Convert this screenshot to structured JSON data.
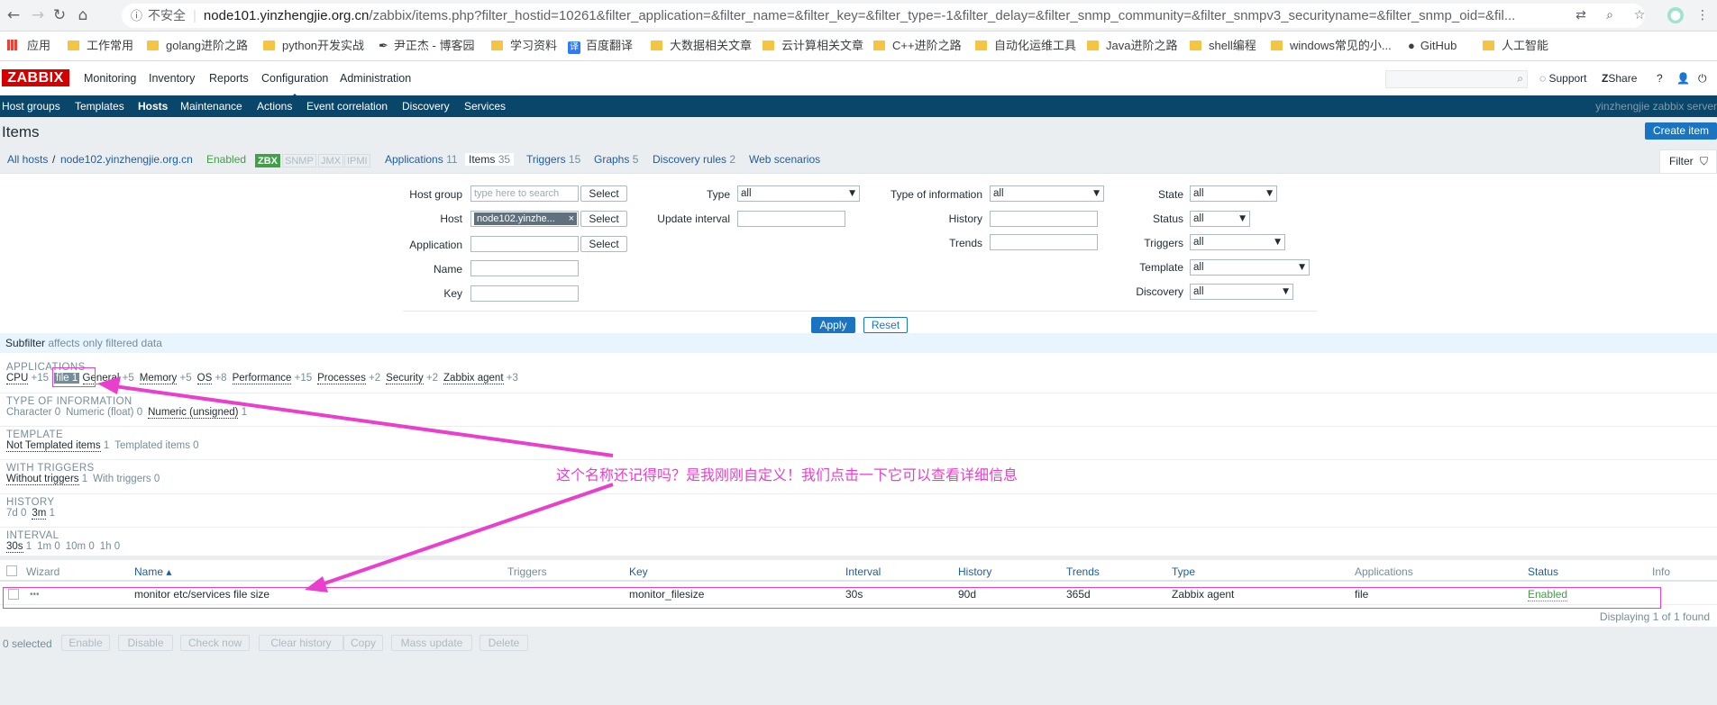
{
  "browser": {
    "insecure_label": "不安全",
    "url_domain": "node101.yinzhengjie.org.cn",
    "url_path": "/zabbix/items.php?filter_hostid=10261&filter_application=&filter_name=&filter_key=&filter_type=-1&filter_delay=&filter_snmp_community=&filter_snmpv3_securityname=&filter_snmp_oid=&fil...",
    "bookmarks": [
      "应用",
      "工作常用",
      "golang进阶之路",
      "python开发实战",
      "尹正杰 - 博客园",
      "学习资料",
      "百度翻译",
      "大数据相关文章",
      "云计算相关文章",
      "C++进阶之路",
      "自动化运维工具",
      "Java进阶之路",
      "shell编程",
      "windows常见的小...",
      "GitHub",
      "人工智能"
    ]
  },
  "zabbix": {
    "logo": "ZABBIX",
    "menu": [
      "Monitoring",
      "Inventory",
      "Reports",
      "Configuration",
      "Administration"
    ],
    "support": "Support",
    "share": "Share",
    "help": "?",
    "submenu": [
      "Host groups",
      "Templates",
      "Hosts",
      "Maintenance",
      "Actions",
      "Event correlation",
      "Discovery",
      "Services"
    ],
    "server_name": "yinzhengjie zabbix server",
    "page_title": "Items",
    "create_item": "Create item",
    "host_nav": {
      "all_hosts": "All hosts",
      "separator": "/",
      "host": "node102.yinzhengjie.org.cn",
      "status": "Enabled",
      "badges": [
        "ZBX",
        "SNMP",
        "JMX",
        "IPMI"
      ],
      "applications": "Applications",
      "applications_count": "11",
      "items": "Items",
      "items_count": "35",
      "triggers": "Triggers",
      "triggers_count": "15",
      "graphs": "Graphs",
      "graphs_count": "5",
      "discovery": "Discovery rules",
      "discovery_count": "2",
      "web": "Web scenarios"
    },
    "filter": {
      "tab": "Filter",
      "host_group_label": "Host group",
      "host_group_placeholder": "type here to search",
      "select": "Select",
      "host_label": "Host",
      "host_chip": "node102.yinzhe...",
      "application_label": "Application",
      "name_label": "Name",
      "key_label": "Key",
      "type_label": "Type",
      "type_value": "all",
      "update_interval_label": "Update interval",
      "type_info_label": "Type of information",
      "type_info_value": "all",
      "history_label": "History",
      "trends_label": "Trends",
      "state_label": "State",
      "state_value": "all",
      "status_label": "Status",
      "status_value": "all",
      "triggers_label": "Triggers",
      "triggers_value": "all",
      "template_label": "Template",
      "template_value": "all",
      "discovery_label": "Discovery",
      "discovery_value": "all",
      "apply": "Apply",
      "reset": "Reset"
    },
    "subfilter": {
      "title": "Subfilter",
      "note": "affects only filtered data",
      "groups": [
        {
          "title": "APPLICATIONS",
          "items": [
            {
              "name": "CPU",
              "count": "+15"
            },
            {
              "name": "file",
              "count": "1",
              "selected": true
            },
            {
              "name": "General",
              "count": "+5"
            },
            {
              "name": "Memory",
              "count": "+5"
            },
            {
              "name": "OS",
              "count": "+8"
            },
            {
              "name": "Performance",
              "count": "+15"
            },
            {
              "name": "Processes",
              "count": "+2"
            },
            {
              "name": "Security",
              "count": "+2"
            },
            {
              "name": "Zabbix agent",
              "count": "+3"
            }
          ]
        },
        {
          "title": "TYPE OF INFORMATION",
          "items": [
            {
              "name": "Character",
              "count": "0",
              "plain": true
            },
            {
              "name": "Numeric (float)",
              "count": "0",
              "plain": true
            },
            {
              "name": "Numeric (unsigned)",
              "count": "1"
            }
          ]
        },
        {
          "title": "TEMPLATE",
          "items": [
            {
              "name": "Not Templated items",
              "count": "1"
            },
            {
              "name": "Templated items",
              "count": "0",
              "plain": true
            }
          ]
        },
        {
          "title": "WITH TRIGGERS",
          "items": [
            {
              "name": "Without triggers",
              "count": "1"
            },
            {
              "name": "With triggers",
              "count": "0",
              "plain": true
            }
          ]
        },
        {
          "title": "HISTORY",
          "items": [
            {
              "name": "7d",
              "count": "0",
              "plain": true
            },
            {
              "name": "3m",
              "count": "1"
            }
          ]
        },
        {
          "title": "INTERVAL",
          "items": [
            {
              "name": "30s",
              "count": "1"
            },
            {
              "name": "1m",
              "count": "0",
              "plain": true
            },
            {
              "name": "10m",
              "count": "0",
              "plain": true
            },
            {
              "name": "1h",
              "count": "0",
              "plain": true
            }
          ]
        }
      ]
    },
    "table": {
      "headers": {
        "wizard": "Wizard",
        "name": "Name ▴",
        "triggers": "Triggers",
        "key": "Key",
        "interval": "Interval",
        "history": "History",
        "trends": "Trends",
        "type": "Type",
        "applications": "Applications",
        "status": "Status",
        "info": "Info"
      },
      "row": {
        "wizard": "•••",
        "name": "monitor etc/services file size",
        "key": "monitor_filesize",
        "interval": "30s",
        "history": "90d",
        "trends": "365d",
        "type": "Zabbix agent",
        "applications": "file",
        "status": "Enabled"
      },
      "displaying": "Displaying 1 of 1 found"
    },
    "bulk": {
      "selected": "0 selected",
      "buttons": [
        "Enable",
        "Disable",
        "Check now",
        "Clear history",
        "Copy",
        "Mass update",
        "Delete"
      ]
    }
  },
  "annotation": {
    "text": "这个名称还记得吗？是我刚刚自定义！我们点击一下它可以查看详细信息",
    "color": "#e93fcc"
  }
}
